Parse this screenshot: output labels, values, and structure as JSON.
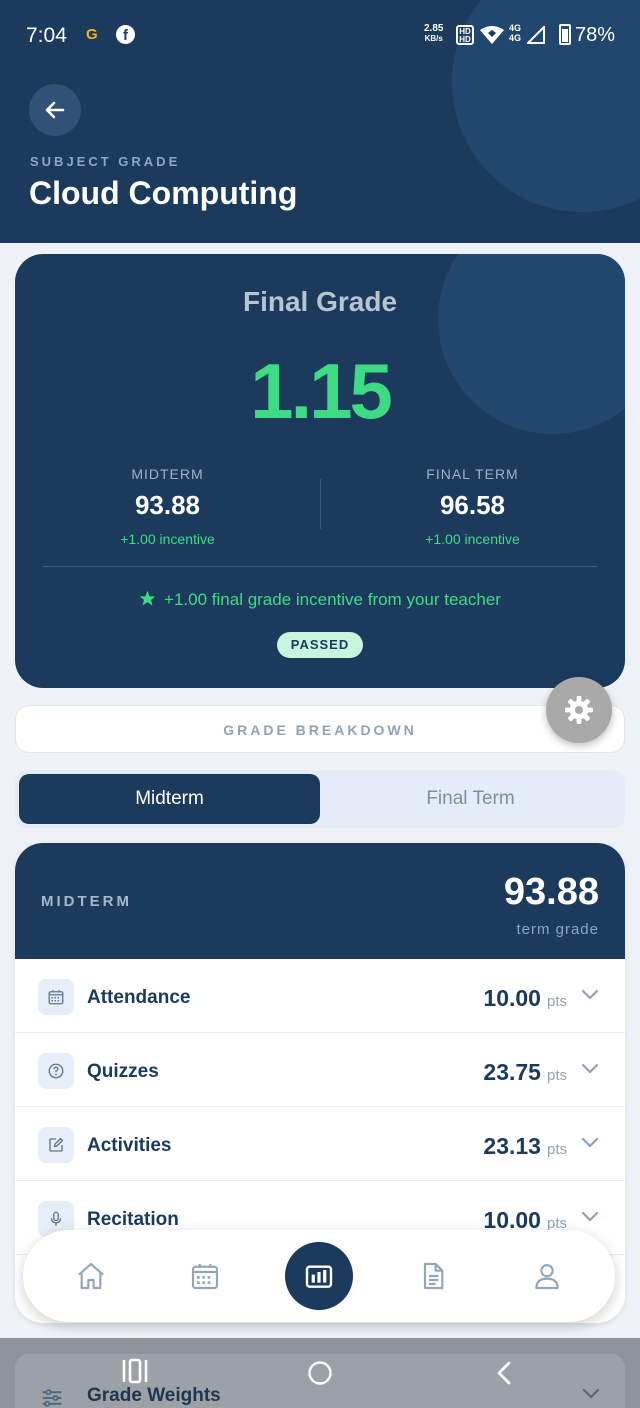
{
  "status_bar": {
    "time": "7:04",
    "speed_value": "2.85",
    "speed_unit": "KB/s",
    "hd_top": "HD",
    "hd_bottom": "HD",
    "net_top": "4G",
    "net_bottom": "4G",
    "battery": "78%"
  },
  "header": {
    "label": "SUBJECT GRADE",
    "title": "Cloud Computing"
  },
  "final_grade": {
    "title": "Final Grade",
    "value": "1.15",
    "midterm": {
      "label": "MIDTERM",
      "value": "93.88",
      "incentive": "+1.00 incentive"
    },
    "final_term": {
      "label": "FINAL TERM",
      "value": "96.58",
      "incentive": "+1.00 incentive"
    },
    "incentive_note": "+1.00 final grade incentive from your teacher",
    "status": "PASSED"
  },
  "breakdown": {
    "label": "GRADE BREAKDOWN"
  },
  "tabs": [
    {
      "label": "Midterm",
      "active": true
    },
    {
      "label": "Final Term",
      "active": false
    }
  ],
  "term_card": {
    "label": "MIDTERM",
    "value": "93.88",
    "sub": "term grade",
    "unit": "pts",
    "rows": [
      {
        "name": "Attendance",
        "points": "10.00",
        "icon": "calendar-icon"
      },
      {
        "name": "Quizzes",
        "points": "23.75",
        "icon": "question-icon"
      },
      {
        "name": "Activities",
        "points": "23.13",
        "icon": "edit-icon"
      },
      {
        "name": "Recitation",
        "points": "10.00",
        "icon": "mic-icon"
      }
    ]
  },
  "hidden_section": {
    "label": "Grade Weights"
  },
  "bottom_nav": [
    "home-icon",
    "calendar-icon",
    "chart-icon",
    "document-icon",
    "profile-icon"
  ],
  "colors": {
    "primary": "#1b3a5c",
    "accent_green": "#3ddc84",
    "background": "#eef2f6"
  }
}
